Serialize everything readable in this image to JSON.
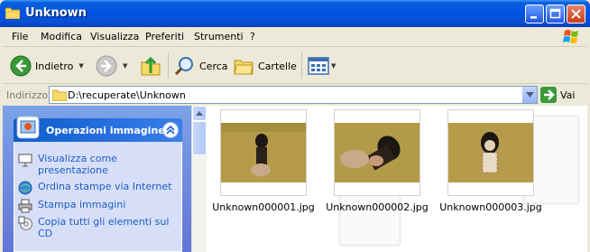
{
  "window": {
    "title": "Unknown",
    "icons": {
      "title": "folder-icon"
    }
  },
  "menu": {
    "items": [
      "File",
      "Modifica",
      "Visualizza",
      "Preferiti",
      "Strumenti",
      "?"
    ]
  },
  "toolbar": {
    "back_label": "Indietro",
    "search_label": "Cerca",
    "folders_label": "Cartelle"
  },
  "address": {
    "label": "Indirizzo",
    "path": "D:\\recuperate\\Unknown",
    "go_label": "Vai"
  },
  "taskpane": {
    "header": "Operazioni immagine",
    "links": [
      {
        "label": "Visualizza come presentazione",
        "icon": "slideshow-icon"
      },
      {
        "label": "Ordina stampe via Internet",
        "icon": "internet-prints-icon"
      },
      {
        "label": "Stampa immagini",
        "icon": "printer-icon"
      },
      {
        "label": "Copia tutti gli elementi sul CD",
        "icon": "cd-copy-icon"
      }
    ]
  },
  "files": [
    {
      "name": "Unknown000001.jpg"
    },
    {
      "name": "Unknown000002.jpg"
    },
    {
      "name": "Unknown000003.jpg"
    }
  ],
  "colors": {
    "titlebar": "#0054e3",
    "taskpane": "#6f8fdf",
    "link": "#215dc6",
    "thumb_bg": "#b39a48"
  }
}
